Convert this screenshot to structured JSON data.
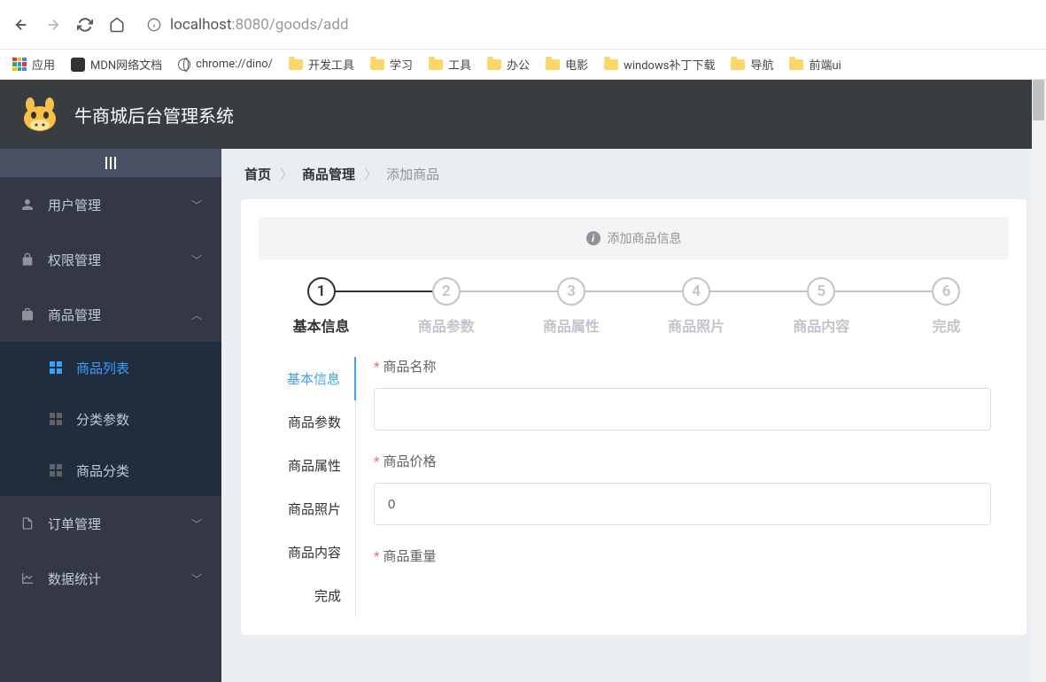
{
  "browser": {
    "url_host": "localhost",
    "url_port": ":8080",
    "url_path": "/goods/add"
  },
  "bookmarks": {
    "apps": "应用",
    "items": [
      "MDN网络文档",
      "chrome://dino/",
      "开发工具",
      "学习",
      "工具",
      "办公",
      "电影",
      "windows补丁下载",
      "导航",
      "前端ui"
    ]
  },
  "app": {
    "title": "牛商城后台管理系统"
  },
  "sidebar": {
    "menus": [
      {
        "label": "用户管理",
        "expanded": false
      },
      {
        "label": "权限管理",
        "expanded": false
      },
      {
        "label": "商品管理",
        "expanded": true,
        "children": [
          {
            "label": "商品列表",
            "active": true
          },
          {
            "label": "分类参数",
            "active": false
          },
          {
            "label": "商品分类",
            "active": false
          }
        ]
      },
      {
        "label": "订单管理",
        "expanded": false
      },
      {
        "label": "数据统计",
        "expanded": false
      }
    ]
  },
  "breadcrumb": {
    "home": "首页",
    "parent": "商品管理",
    "current": "添加商品"
  },
  "alert": {
    "text": "添加商品信息"
  },
  "steps": [
    {
      "num": "1",
      "title": "基本信息",
      "active": true
    },
    {
      "num": "2",
      "title": "商品参数",
      "active": false
    },
    {
      "num": "3",
      "title": "商品属性",
      "active": false
    },
    {
      "num": "4",
      "title": "商品照片",
      "active": false
    },
    {
      "num": "5",
      "title": "商品内容",
      "active": false
    },
    {
      "num": "6",
      "title": "完成",
      "active": false
    }
  ],
  "tabs": [
    {
      "label": "基本信息",
      "active": true
    },
    {
      "label": "商品参数",
      "active": false
    },
    {
      "label": "商品属性",
      "active": false
    },
    {
      "label": "商品照片",
      "active": false
    },
    {
      "label": "商品内容",
      "active": false
    },
    {
      "label": "完成",
      "active": false
    }
  ],
  "form": {
    "name_label": "商品名称",
    "name_value": "",
    "price_label": "商品价格",
    "price_value": "0",
    "weight_label": "商品重量",
    "required_mark": "*"
  }
}
